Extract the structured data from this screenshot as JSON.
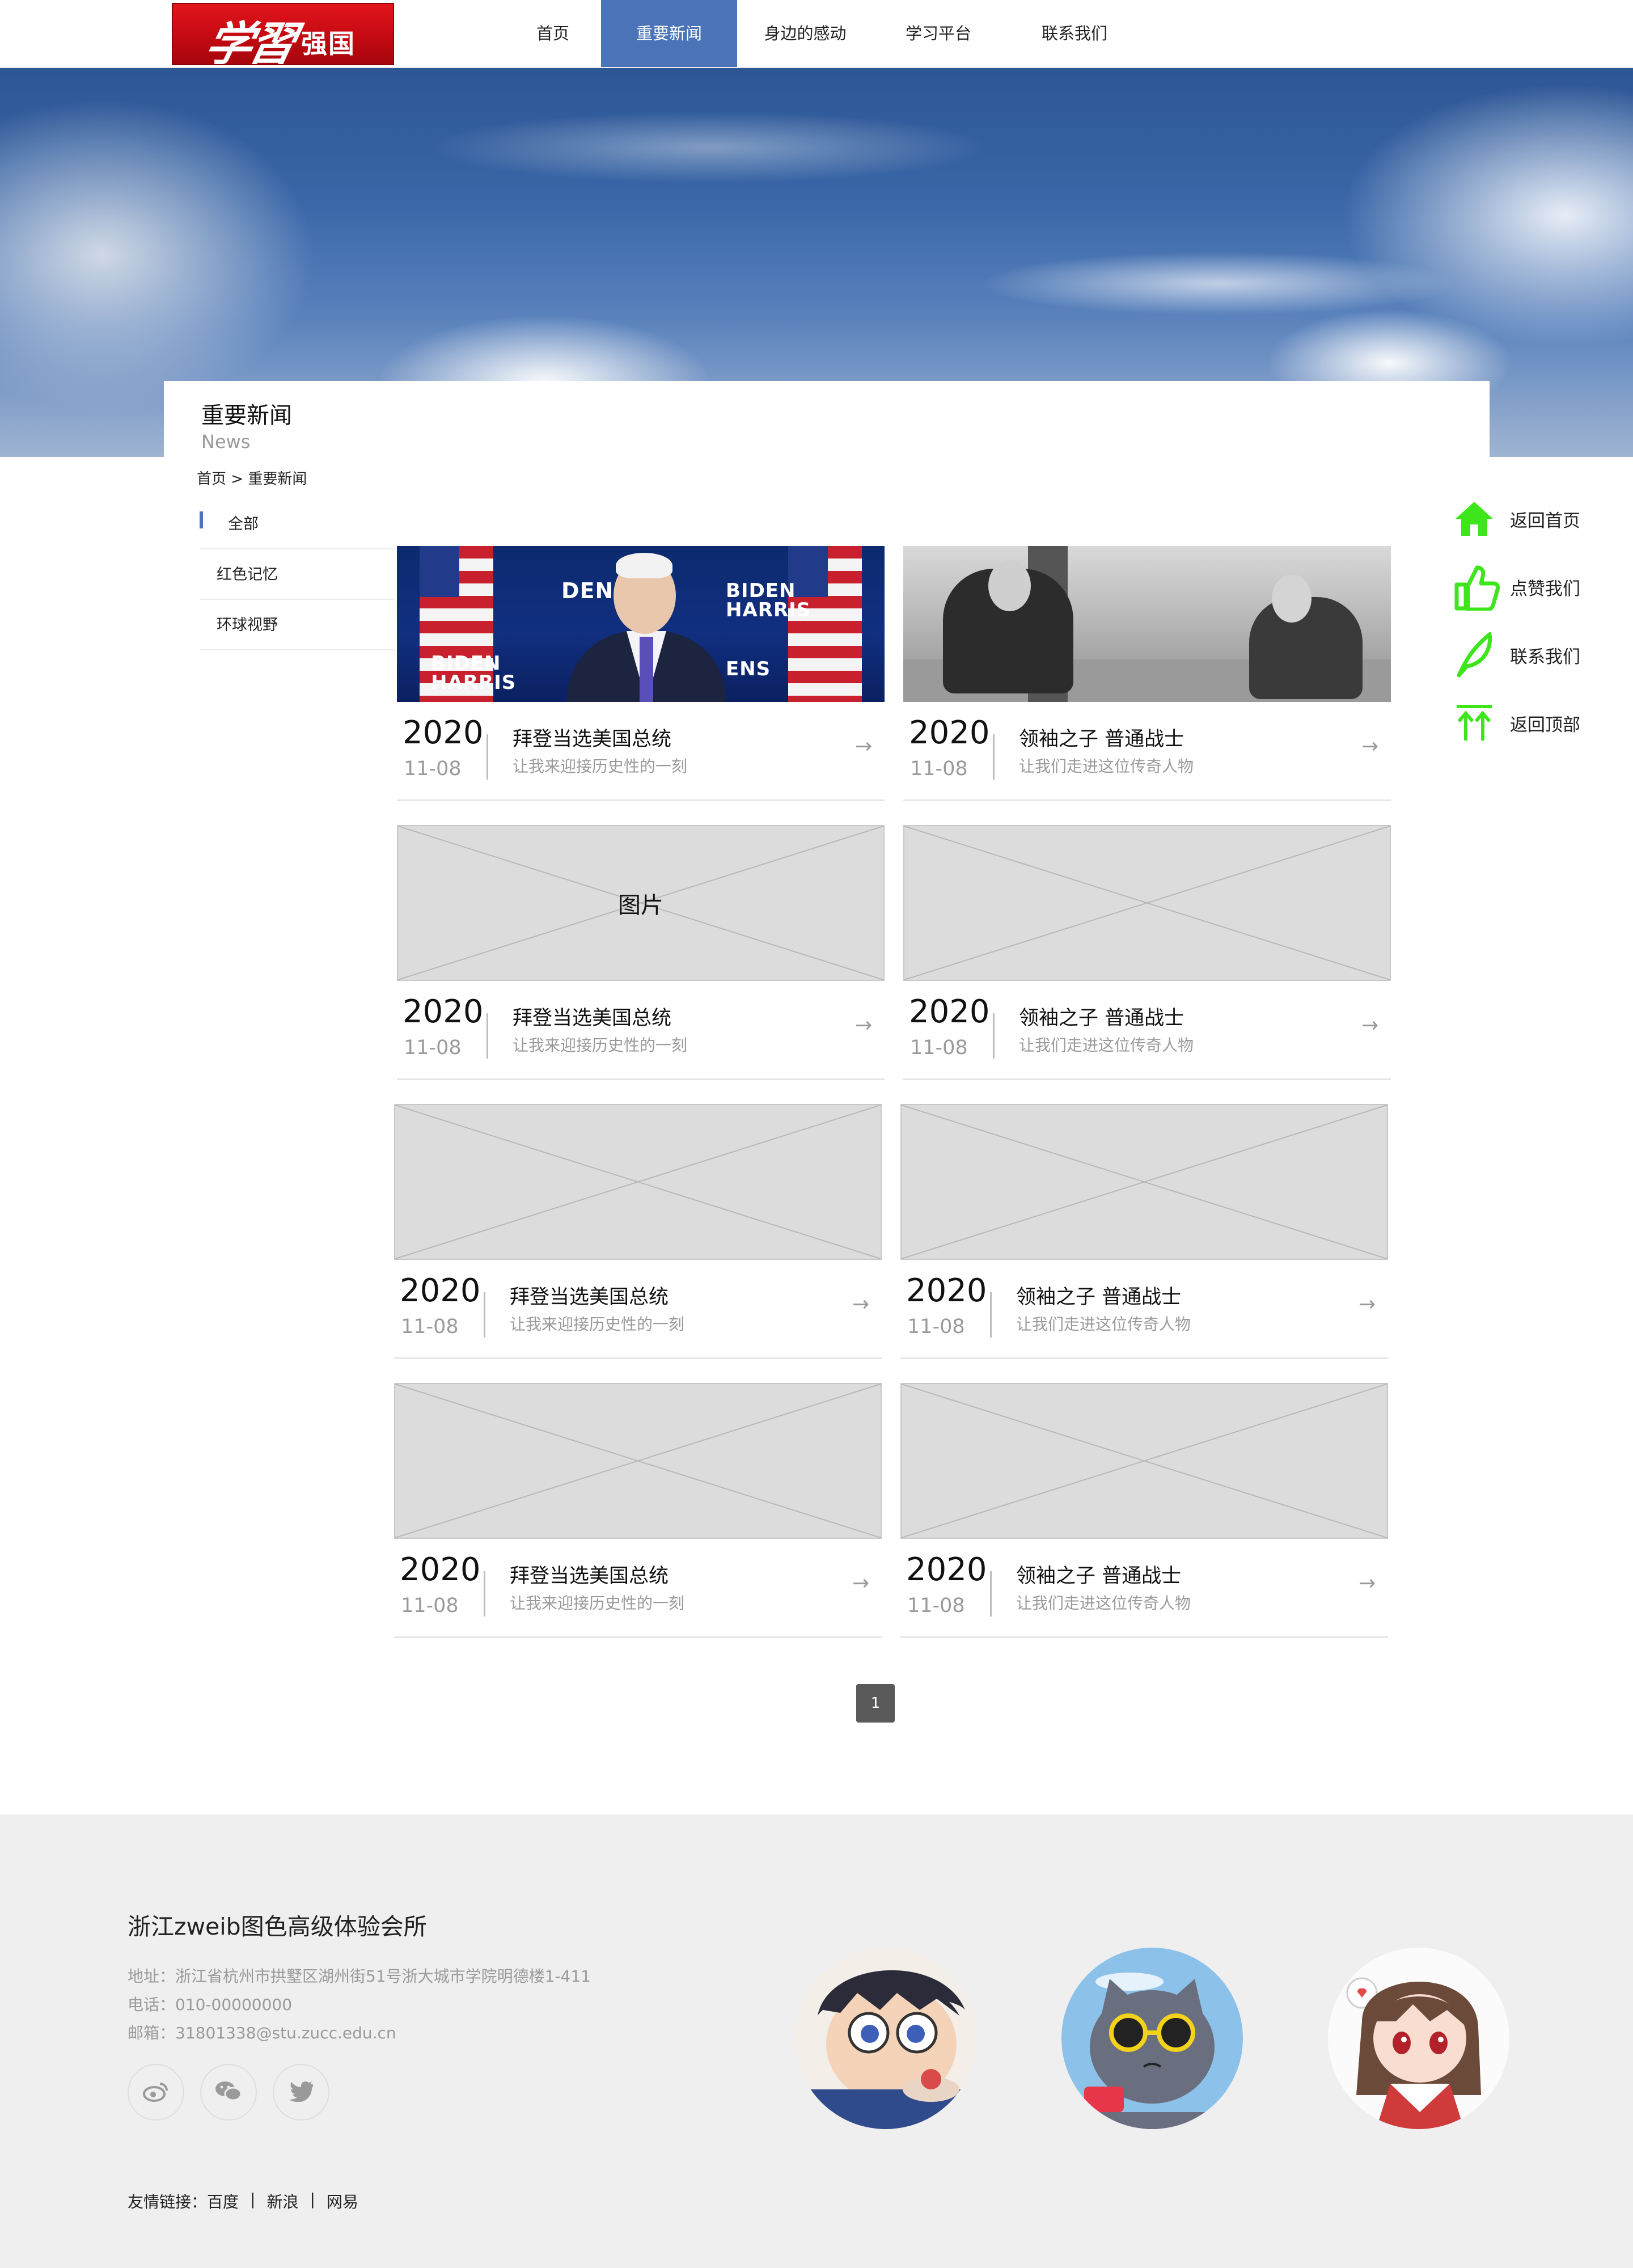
{
  "header": {
    "logo": "学习强国",
    "nav": [
      {
        "label": "首页",
        "active": false
      },
      {
        "label": "重要新闻",
        "active": true
      },
      {
        "label": "身边的感动",
        "active": false
      },
      {
        "label": "学习平台",
        "active": false
      },
      {
        "label": "联系我们",
        "active": false
      }
    ]
  },
  "banner": {
    "title": "重要新闻",
    "subtitle": "News"
  },
  "breadcrumb": "首页 > 重要新闻",
  "sidebar": {
    "items": [
      {
        "label": "全部",
        "active": true
      },
      {
        "label": "红色记忆",
        "active": false
      },
      {
        "label": "环球视野",
        "active": false
      }
    ]
  },
  "float_bar": [
    {
      "label": "返回首页",
      "icon": "home-icon"
    },
    {
      "label": "点赞我们",
      "icon": "thumbs-up-icon"
    },
    {
      "label": "联系我们",
      "icon": "feather-icon"
    },
    {
      "label": "返回顶部",
      "icon": "back-to-top-icon"
    }
  ],
  "news": [
    {
      "year": "2020",
      "date": "11-08",
      "title": "拜登当选美国总统",
      "desc": "让我来迎接历史性的一刻",
      "image": "election-photo",
      "image_label": ""
    },
    {
      "year": "2020",
      "date": "11-08",
      "title": "领袖之子 普通战士",
      "desc": "让我们走进这位传奇人物",
      "image": "black-white-photo",
      "image_label": ""
    },
    {
      "year": "2020",
      "date": "11-08",
      "title": "拜登当选美国总统",
      "desc": "让我来迎接历史性的一刻",
      "image": "placeholder",
      "image_label": "图片"
    },
    {
      "year": "2020",
      "date": "11-08",
      "title": "领袖之子 普通战士",
      "desc": "让我们走进这位传奇人物",
      "image": "placeholder",
      "image_label": ""
    },
    {
      "year": "2020",
      "date": "11-08",
      "title": "拜登当选美国总统",
      "desc": "让我来迎接历史性的一刻",
      "image": "placeholder",
      "image_label": ""
    },
    {
      "year": "2020",
      "date": "11-08",
      "title": "领袖之子 普通战士",
      "desc": "让我们走进这位传奇人物",
      "image": "placeholder",
      "image_label": ""
    },
    {
      "year": "2020",
      "date": "11-08",
      "title": "拜登当选美国总统",
      "desc": "让我来迎接历史性的一刻",
      "image": "placeholder",
      "image_label": ""
    },
    {
      "year": "2020",
      "date": "11-08",
      "title": "领袖之子 普通战士",
      "desc": "让我们走进这位传奇人物",
      "image": "placeholder",
      "image_label": ""
    }
  ],
  "pagination": {
    "current": "1"
  },
  "footer": {
    "title": "浙江zweib图色高级体验会所",
    "address": "地址：浙江省杭州市拱墅区湖州街51号浙大城市学院明德楼1-411",
    "phone": "电话：010-00000000",
    "email": "邮箱：31801338@stu.zucc.edu.cn",
    "social": [
      "weibo-icon",
      "wechat-icon",
      "twitter-icon"
    ],
    "links_label": "友情链接：",
    "links": [
      "百度",
      "新浪",
      "网易"
    ],
    "avatars": [
      "anime-boy-avatar",
      "cat-sunglasses-avatar",
      "anime-girl-avatar"
    ]
  },
  "colors": {
    "accent": "#4b74b8",
    "float_icon": "#3de61b",
    "footer_bg": "#efefef"
  }
}
